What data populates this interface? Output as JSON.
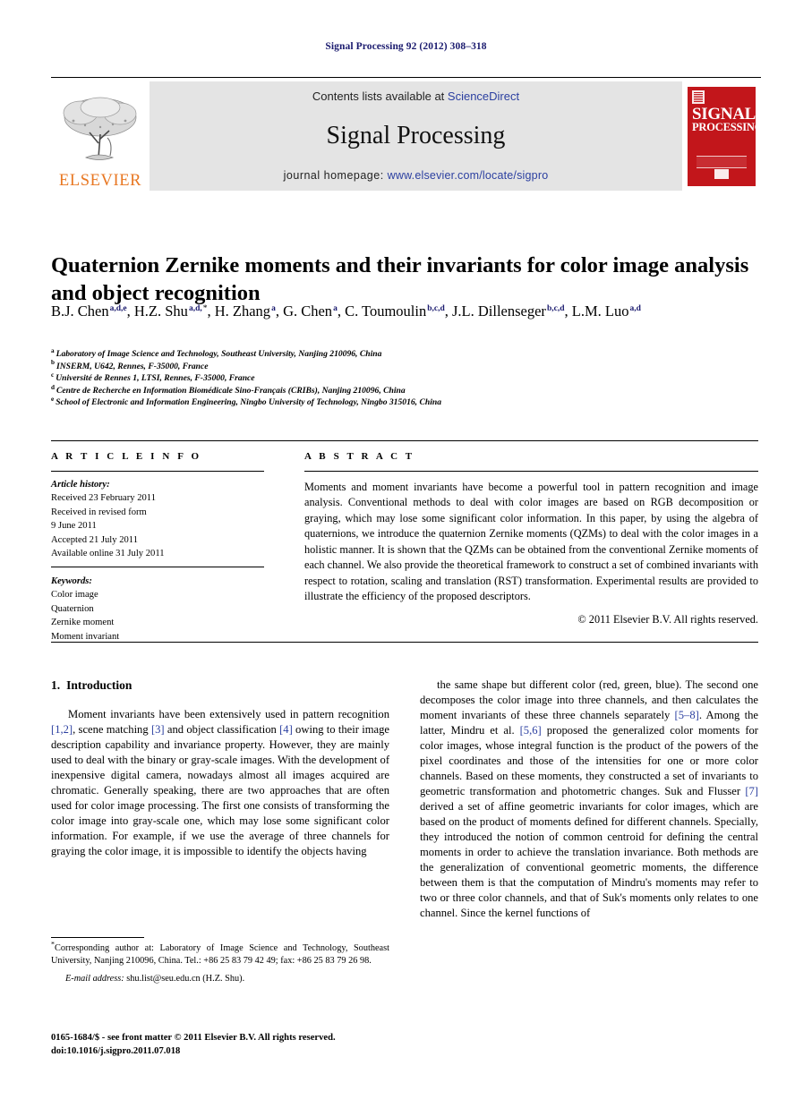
{
  "running_head": "Signal Processing 92 (2012) 308–318",
  "masthead": {
    "publisher_wordmark": "ELSEVIER",
    "contents_prefix": "Contents lists available at ",
    "contents_link": "ScienceDirect",
    "journal_name": "Signal Processing",
    "homepage_prefix": "journal homepage: ",
    "homepage_url": "www.elsevier.com/locate/sigpro",
    "cover_title_line1": "SIGNAL",
    "cover_title_line2": "PROCESSING",
    "link_color": "#2b3fa0",
    "cover_color": "#c2161b",
    "banner_color": "#e4e4e4",
    "elsevier_orange": "#E87722"
  },
  "article": {
    "title": "Quaternion Zernike moments and their invariants for color image analysis and object recognition",
    "authors": [
      {
        "name": "B.J. Chen",
        "sup": "a,d,e",
        "sep": ", "
      },
      {
        "name": "H.Z. Shu",
        "sup": "a,d,",
        "star": "*",
        "sep": ", "
      },
      {
        "name": "H. Zhang",
        "sup": "a",
        "sep": ", "
      },
      {
        "name": "G. Chen",
        "sup": "a",
        "sep": ", "
      },
      {
        "name": "C. Toumoulin",
        "sup": "b,c,d",
        "sep": ", "
      },
      {
        "name": "J.L. Dillenseger",
        "sup": "b,c,d",
        "sep": ", "
      },
      {
        "name": "L.M. Luo",
        "sup": "a,d",
        "sep": ""
      }
    ],
    "affiliations": [
      {
        "label": "a",
        "text": "Laboratory of Image Science and Technology, Southeast University, Nanjing 210096, China"
      },
      {
        "label": "b",
        "text": "INSERM, U642, Rennes, F-35000, France"
      },
      {
        "label": "c",
        "text": "Université de Rennes 1, LTSI, Rennes, F-35000, France"
      },
      {
        "label": "d",
        "text": "Centre de Recherche en Information Biomédicale Sino-Français (CRIBs), Nanjing 210096, China"
      },
      {
        "label": "e",
        "text": "School of Electronic and Information Engineering, Ningbo University of Technology, Ningbo 315016, China"
      }
    ]
  },
  "article_info": {
    "heading": "A R T I C L E   I N F O",
    "history_label": "Article history:",
    "history": [
      "Received 23 February 2011",
      "Received in revised form",
      "9 June 2011",
      "Accepted 21 July 2011",
      "Available online 31 July 2011"
    ],
    "keywords_label": "Keywords:",
    "keywords": [
      "Color image",
      "Quaternion",
      "Zernike moment",
      "Moment invariant"
    ]
  },
  "abstract": {
    "heading": "A B S T R A C T",
    "text": "Moments and moment invariants have become a powerful tool in pattern recognition and image analysis. Conventional methods to deal with color images are based on RGB decomposition or graying, which may lose some significant color information. In this paper, by using the algebra of quaternions, we introduce the quaternion Zernike moments (QZMs) to deal with the color images in a holistic manner. It is shown that the QZMs can be obtained from the conventional Zernike moments of each channel. We also provide the theoretical framework to construct a set of combined invariants with respect to rotation, scaling and translation (RST) transformation. Experimental results are provided to illustrate the efficiency of the proposed descriptors.",
    "copyright": "© 2011 Elsevier B.V. All rights reserved."
  },
  "introduction": {
    "number": "1.",
    "heading": "Introduction",
    "left_para_html": "Moment invariants have been extensively used in pattern recognition [1,2], scene matching [3] and object classification [4] owing to their image description capability and invariance property. However, they are mainly used to deal with the binary or gray-scale images. With the development of inexpensive digital camera, nowadays almost all images acquired are chromatic. Generally speaking, there are two approaches that are often used for color image processing. The first one consists of transforming the color image into gray-scale one, which may lose some significant color information. For example, if we use the average of three channels for graying the color image, it is impossible to identify the objects having",
    "right_para_html": "the same shape but different color (red, green, blue). The second one decomposes the color image into three channels, and then calculates the moment invariants of these three channels separately [5–8]. Among the latter, Mindru et al. [5,6] proposed the generalized color moments for color images, whose integral function is the product of the powers of the pixel coordinates and those of the intensities for one or more color channels. Based on these moments, they constructed a set of invariants to geometric transformation and photometric changes. Suk and Flusser [7] derived a set of affine geometric invariants for color images, which are based on the product of moments defined for different channels. Specially, they introduced the notion of common centroid for defining the central moments in order to achieve the translation invariance. Both methods are the generalization of conventional geometric moments, the difference between them is that the computation of Mindru's moments may refer to two or three color channels, and that of Suk's moments only relates to one channel. Since the kernel functions of"
  },
  "footnote": {
    "corresponding": "Corresponding author at: Laboratory of Image Science and Technology, Southeast University, Nanjing 210096, China. Tel.: +86 25 83 79 42 49; fax: +86 25 83 79 26 98.",
    "email_label": "E-mail address:",
    "email": "shu.list@seu.edu.cn (H.Z. Shu).",
    "issn_line": "0165-1684/$ - see front matter © 2011 Elsevier B.V. All rights reserved.",
    "doi_line": "doi:10.1016/j.sigpro.2011.07.018"
  }
}
